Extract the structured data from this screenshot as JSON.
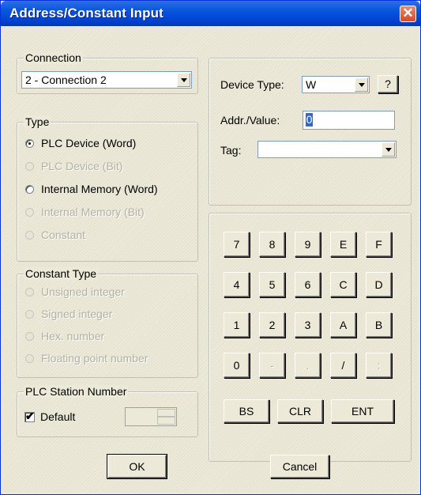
{
  "window": {
    "title": "Address/Constant Input",
    "close_glyph": "✕"
  },
  "connection": {
    "legend": "Connection",
    "selected": "2 - Connection 2"
  },
  "type": {
    "legend": "Type",
    "options": [
      {
        "label": "PLC Device (Word)",
        "checked": true,
        "enabled": true
      },
      {
        "label": "PLC Device (Bit)",
        "checked": false,
        "enabled": false
      },
      {
        "label": "Internal Memory (Word)",
        "checked": false,
        "enabled": true
      },
      {
        "label": "Internal Memory (Bit)",
        "checked": false,
        "enabled": false
      },
      {
        "label": "Constant",
        "checked": false,
        "enabled": false
      }
    ]
  },
  "constant_type": {
    "legend": "Constant Type",
    "options": [
      {
        "label": "Unsigned integer",
        "enabled": false
      },
      {
        "label": "Signed integer",
        "enabled": false
      },
      {
        "label": "Hex. number",
        "enabled": false
      },
      {
        "label": "Floating point number",
        "enabled": false
      }
    ]
  },
  "station": {
    "legend": "PLC Station Number",
    "default_label": "Default",
    "default_checked": true,
    "check_glyph": "✔",
    "value": ""
  },
  "device": {
    "device_type_label": "Device Type:",
    "device_type_value": "W",
    "help_label": "?",
    "addr_label": "Addr./Value:",
    "addr_value": "0",
    "tag_label": "Tag:",
    "tag_value": ""
  },
  "keypad": {
    "rows": [
      [
        {
          "label": "7",
          "enabled": true
        },
        {
          "label": "8",
          "enabled": true
        },
        {
          "label": "9",
          "enabled": true
        },
        {
          "label": "E",
          "enabled": true
        },
        {
          "label": "F",
          "enabled": true
        }
      ],
      [
        {
          "label": "4",
          "enabled": true
        },
        {
          "label": "5",
          "enabled": true
        },
        {
          "label": "6",
          "enabled": true
        },
        {
          "label": "C",
          "enabled": true
        },
        {
          "label": "D",
          "enabled": true
        }
      ],
      [
        {
          "label": "1",
          "enabled": true
        },
        {
          "label": "2",
          "enabled": true
        },
        {
          "label": "3",
          "enabled": true
        },
        {
          "label": "A",
          "enabled": true
        },
        {
          "label": "B",
          "enabled": true
        }
      ],
      [
        {
          "label": "0",
          "enabled": true
        },
        {
          "label": "-",
          "enabled": false
        },
        {
          "label": ".",
          "enabled": false
        },
        {
          "label": "/",
          "enabled": true
        },
        {
          "label": ":",
          "enabled": false
        }
      ]
    ],
    "bs_label": "BS",
    "clr_label": "CLR",
    "ent_label": "ENT"
  },
  "footer": {
    "ok_label": "OK",
    "cancel_label": "Cancel"
  }
}
